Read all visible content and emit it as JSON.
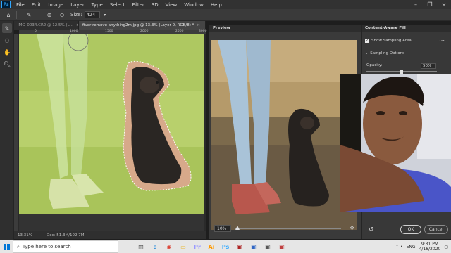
{
  "menubar": {
    "items": [
      "File",
      "Edit",
      "Image",
      "Layer",
      "Type",
      "Select",
      "Filter",
      "3D",
      "View",
      "Window",
      "Help"
    ]
  },
  "options": {
    "size_label": "Size:",
    "size_value": "424"
  },
  "document_tabs": [
    {
      "label": "IMG_0034.CR2 @ 12.5% (L...",
      "close": "×"
    },
    {
      "label": "fiver remove anything2m.jpg @ 13.3% (Layer 0, RGB/8) *",
      "close": "×"
    }
  ],
  "ruler": {
    "ticks": [
      "0",
      "1000",
      "1500",
      "2000",
      "2500",
      "3000"
    ]
  },
  "status": {
    "zoom": "13.31%",
    "doc": "Doc: 51.3M/102.7M"
  },
  "preview": {
    "title": "Preview",
    "zoom_value": "10%",
    "zoom_fraction": 0.02
  },
  "content_aware_fill": {
    "title": "Content-Aware Fill",
    "show_sampling_area": "Show Sampling Area",
    "sampling_options": "Sampling Options",
    "opacity_label": "Opacity:",
    "opacity_value": "50%",
    "opacity_fraction": 0.5,
    "ok": "OK",
    "cancel": "Cancel"
  },
  "taskbar": {
    "search_placeholder": "Type here to search",
    "lang": "ENG",
    "time": "9:31 PM",
    "date": "4/18/2020"
  },
  "colors": {
    "sampling_overlay": "#b5cf6a",
    "ps_blue": "#31a8ff"
  }
}
